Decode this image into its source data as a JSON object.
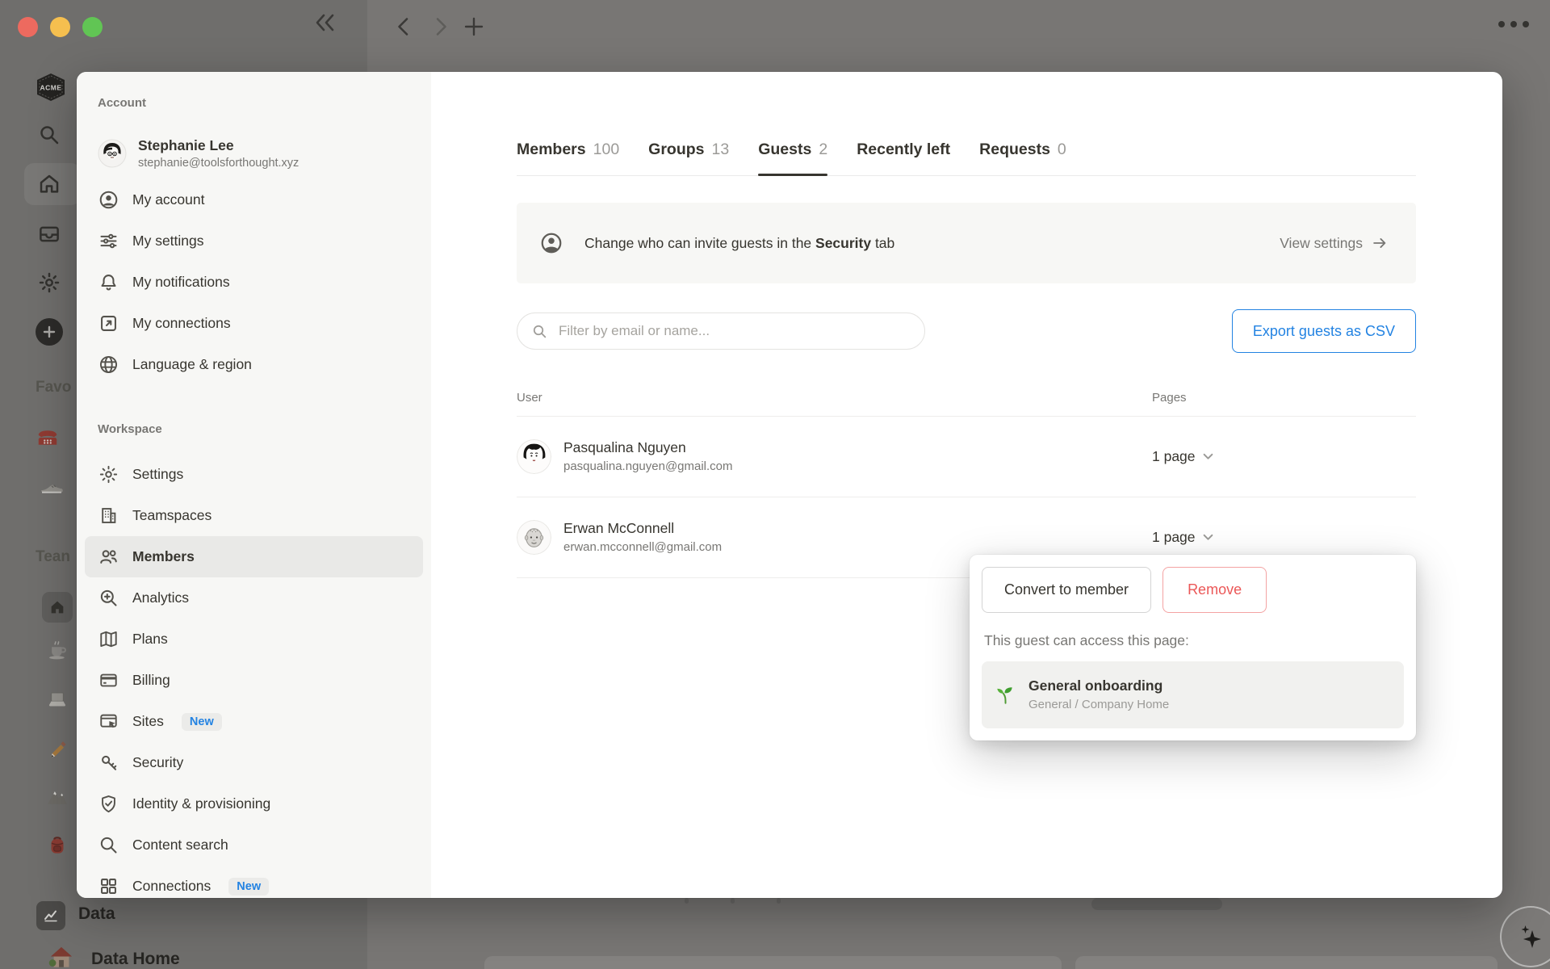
{
  "chrome": {
    "icons": [
      "traffic-red",
      "traffic-yellow",
      "traffic-green",
      "sidebar-collapse",
      "nav-back",
      "nav-forward",
      "new-tab",
      "more-options",
      "ai-sparkle"
    ]
  },
  "rail": {
    "workspace_logo": "ACME",
    "favorites_label": "Favo",
    "teamspaces_label": "Tean",
    "data_label": "Data",
    "data_home_label": "Data Home"
  },
  "panel": {
    "account": {
      "label": "Account",
      "user": {
        "name": "Stephanie Lee",
        "email": "stephanie@toolsforthought.xyz"
      },
      "items": [
        {
          "label": "My account",
          "icon": "person-circle-icon"
        },
        {
          "label": "My settings",
          "icon": "sliders-icon"
        },
        {
          "label": "My notifications",
          "icon": "bell-icon"
        },
        {
          "label": "My connections",
          "icon": "arrow-up-right-square-icon"
        },
        {
          "label": "Language & region",
          "icon": "globe-icon"
        }
      ]
    },
    "workspace": {
      "label": "Workspace",
      "items": [
        {
          "label": "Settings",
          "icon": "gear-icon"
        },
        {
          "label": "Teamspaces",
          "icon": "building-icon"
        },
        {
          "label": "Members",
          "icon": "people-icon",
          "selected": true
        },
        {
          "label": "Analytics",
          "icon": "magnifier-plus-icon"
        },
        {
          "label": "Plans",
          "icon": "map-icon"
        },
        {
          "label": "Billing",
          "icon": "credit-card-icon"
        },
        {
          "label": "Sites",
          "icon": "browser-cursor-icon",
          "badge": "New"
        },
        {
          "label": "Security",
          "icon": "key-icon"
        },
        {
          "label": "Identity & provisioning",
          "icon": "shield-check-icon"
        },
        {
          "label": "Content search",
          "icon": "magnifier-icon"
        },
        {
          "label": "Connections",
          "icon": "grid-icon",
          "badge": "New"
        }
      ]
    }
  },
  "main": {
    "tabs": [
      {
        "label": "Members",
        "count": "100"
      },
      {
        "label": "Groups",
        "count": "13"
      },
      {
        "label": "Guests",
        "count": "2",
        "active": true
      },
      {
        "label": "Recently left"
      },
      {
        "label": "Requests",
        "count": "0"
      }
    ],
    "banner": {
      "text_before": "Change who can invite guests in the ",
      "text_bold": "Security",
      "text_after": " tab",
      "action": "View settings"
    },
    "toolbar": {
      "search_placeholder": "Filter by email or name...",
      "export_label": "Export guests as CSV"
    },
    "table": {
      "headers": {
        "user": "User",
        "pages": "Pages"
      },
      "rows": [
        {
          "name": "Pasqualina Nguyen",
          "email": "pasqualina.nguyen@gmail.com",
          "pages": "1 page"
        },
        {
          "name": "Erwan McConnell",
          "email": "erwan.mcconnell@gmail.com",
          "pages": "1 page"
        }
      ]
    },
    "popover": {
      "convert_label": "Convert to member",
      "remove_label": "Remove",
      "caption": "This guest can access this page:",
      "page": {
        "icon": "seedling-icon",
        "title": "General onboarding",
        "path": "General / Company Home"
      }
    }
  },
  "colors": {
    "accent_blue": "#2383e2",
    "danger_red": "#eb5757",
    "panel_bg": "#f7f7f5",
    "text_dark": "#37352f",
    "text_gray": "#787774"
  }
}
